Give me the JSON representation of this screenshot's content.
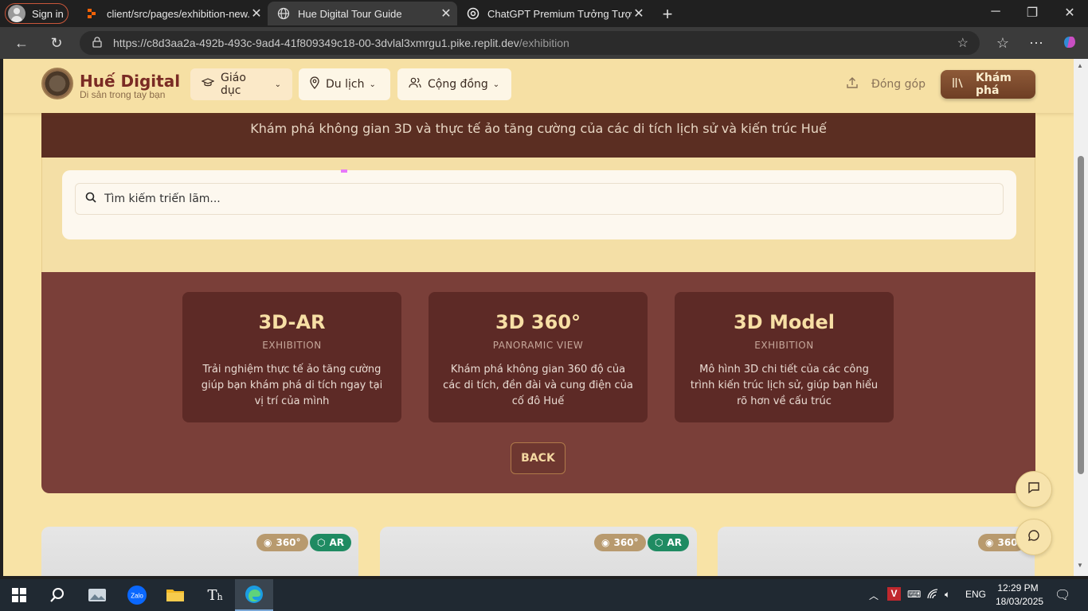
{
  "browser": {
    "signin_label": "Sign in",
    "tabs": [
      {
        "title": "client/src/pages/exhibition-new.t",
        "icon": "replit-icon",
        "active": false
      },
      {
        "title": "Hue Digital Tour Guide",
        "icon": "globe-icon",
        "active": true
      },
      {
        "title": "ChatGPT Premium Tưởng Tượng",
        "icon": "chatgpt-icon",
        "active": false
      }
    ],
    "url": {
      "domain": "https://c8d3aa2a-492b-493c-9ad4-41f809349c18-00-3dvlal3xmrgu1.pike.replit.dev",
      "path": "/exhibition"
    }
  },
  "header": {
    "brand": "Huế Digital",
    "tagline": "Di sản trong tay bạn",
    "nav": [
      {
        "label": "Giáo dục"
      },
      {
        "label": "Du lịch"
      },
      {
        "label": "Cộng đồng"
      }
    ],
    "contribute_label": "Đóng góp",
    "explore_label": "Khám phá"
  },
  "hero": {
    "subtitle": "Khám phá không gian 3D và thực tế ảo tăng cường của các di tích lịch sử và kiến trúc Huế"
  },
  "search": {
    "placeholder": "Tìm kiếm triển lãm..."
  },
  "modes": [
    {
      "title": "3D-AR",
      "subtitle": "EXHIBITION",
      "description": "Trải nghiệm thực tế ảo tăng cường giúp bạn khám phá di tích ngay tại vị trí của mình"
    },
    {
      "title": "3D 360°",
      "subtitle": "PANORAMIC VIEW",
      "description": "Khám phá không gian 360 độ của các di tích, đền đài và cung điện của cố đô Huế"
    },
    {
      "title": "3D Model",
      "subtitle": "EXHIBITION",
      "description": "Mô hình 3D chi tiết của các công trình kiến trúc lịch sử, giúp bạn hiểu rõ hơn về cấu trúc"
    }
  ],
  "back_label": "BACK",
  "cards": [
    {
      "badge_360": "360°",
      "badge_ar": "AR"
    },
    {
      "badge_360": "360°",
      "badge_ar": "AR"
    },
    {
      "badge_360": "360"
    }
  ],
  "taskbar": {
    "lang": "ENG",
    "time": "12:29 PM",
    "date": "18/03/2025"
  },
  "colors": {
    "header_bg": "#f6e0a4",
    "brand": "#7a2b24",
    "hero_bg": "#5b2e22",
    "mode_section_bg": "#7a3f39",
    "mode_card_bg": "#5d2a26",
    "mode_title": "#f7dfa5",
    "badge_360": "#b89a6e",
    "badge_ar": "#1f8b62"
  }
}
